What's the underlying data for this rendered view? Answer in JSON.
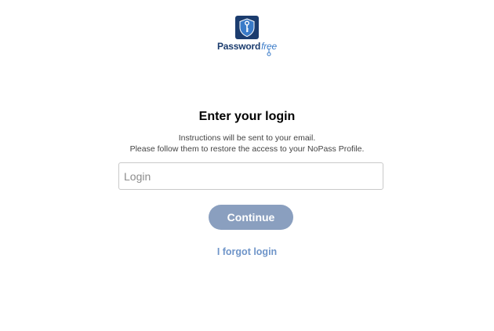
{
  "logo": {
    "word_main": "Password",
    "word_accent": "free",
    "icon": "shield-key-icon",
    "brand_color": "#1b3c6e",
    "accent_color": "#3a7bc8"
  },
  "form": {
    "heading": "Enter your login",
    "instructions_line1": "Instructions will be sent to your email.",
    "instructions_line2": "Please follow them to restore the access to your NoPass Profile.",
    "login_placeholder": "Login",
    "login_value": "",
    "continue_label": "Continue",
    "continue_color": "#8a9fbf",
    "forgot_label": "I forgot login",
    "forgot_color": "#6f95c9"
  }
}
